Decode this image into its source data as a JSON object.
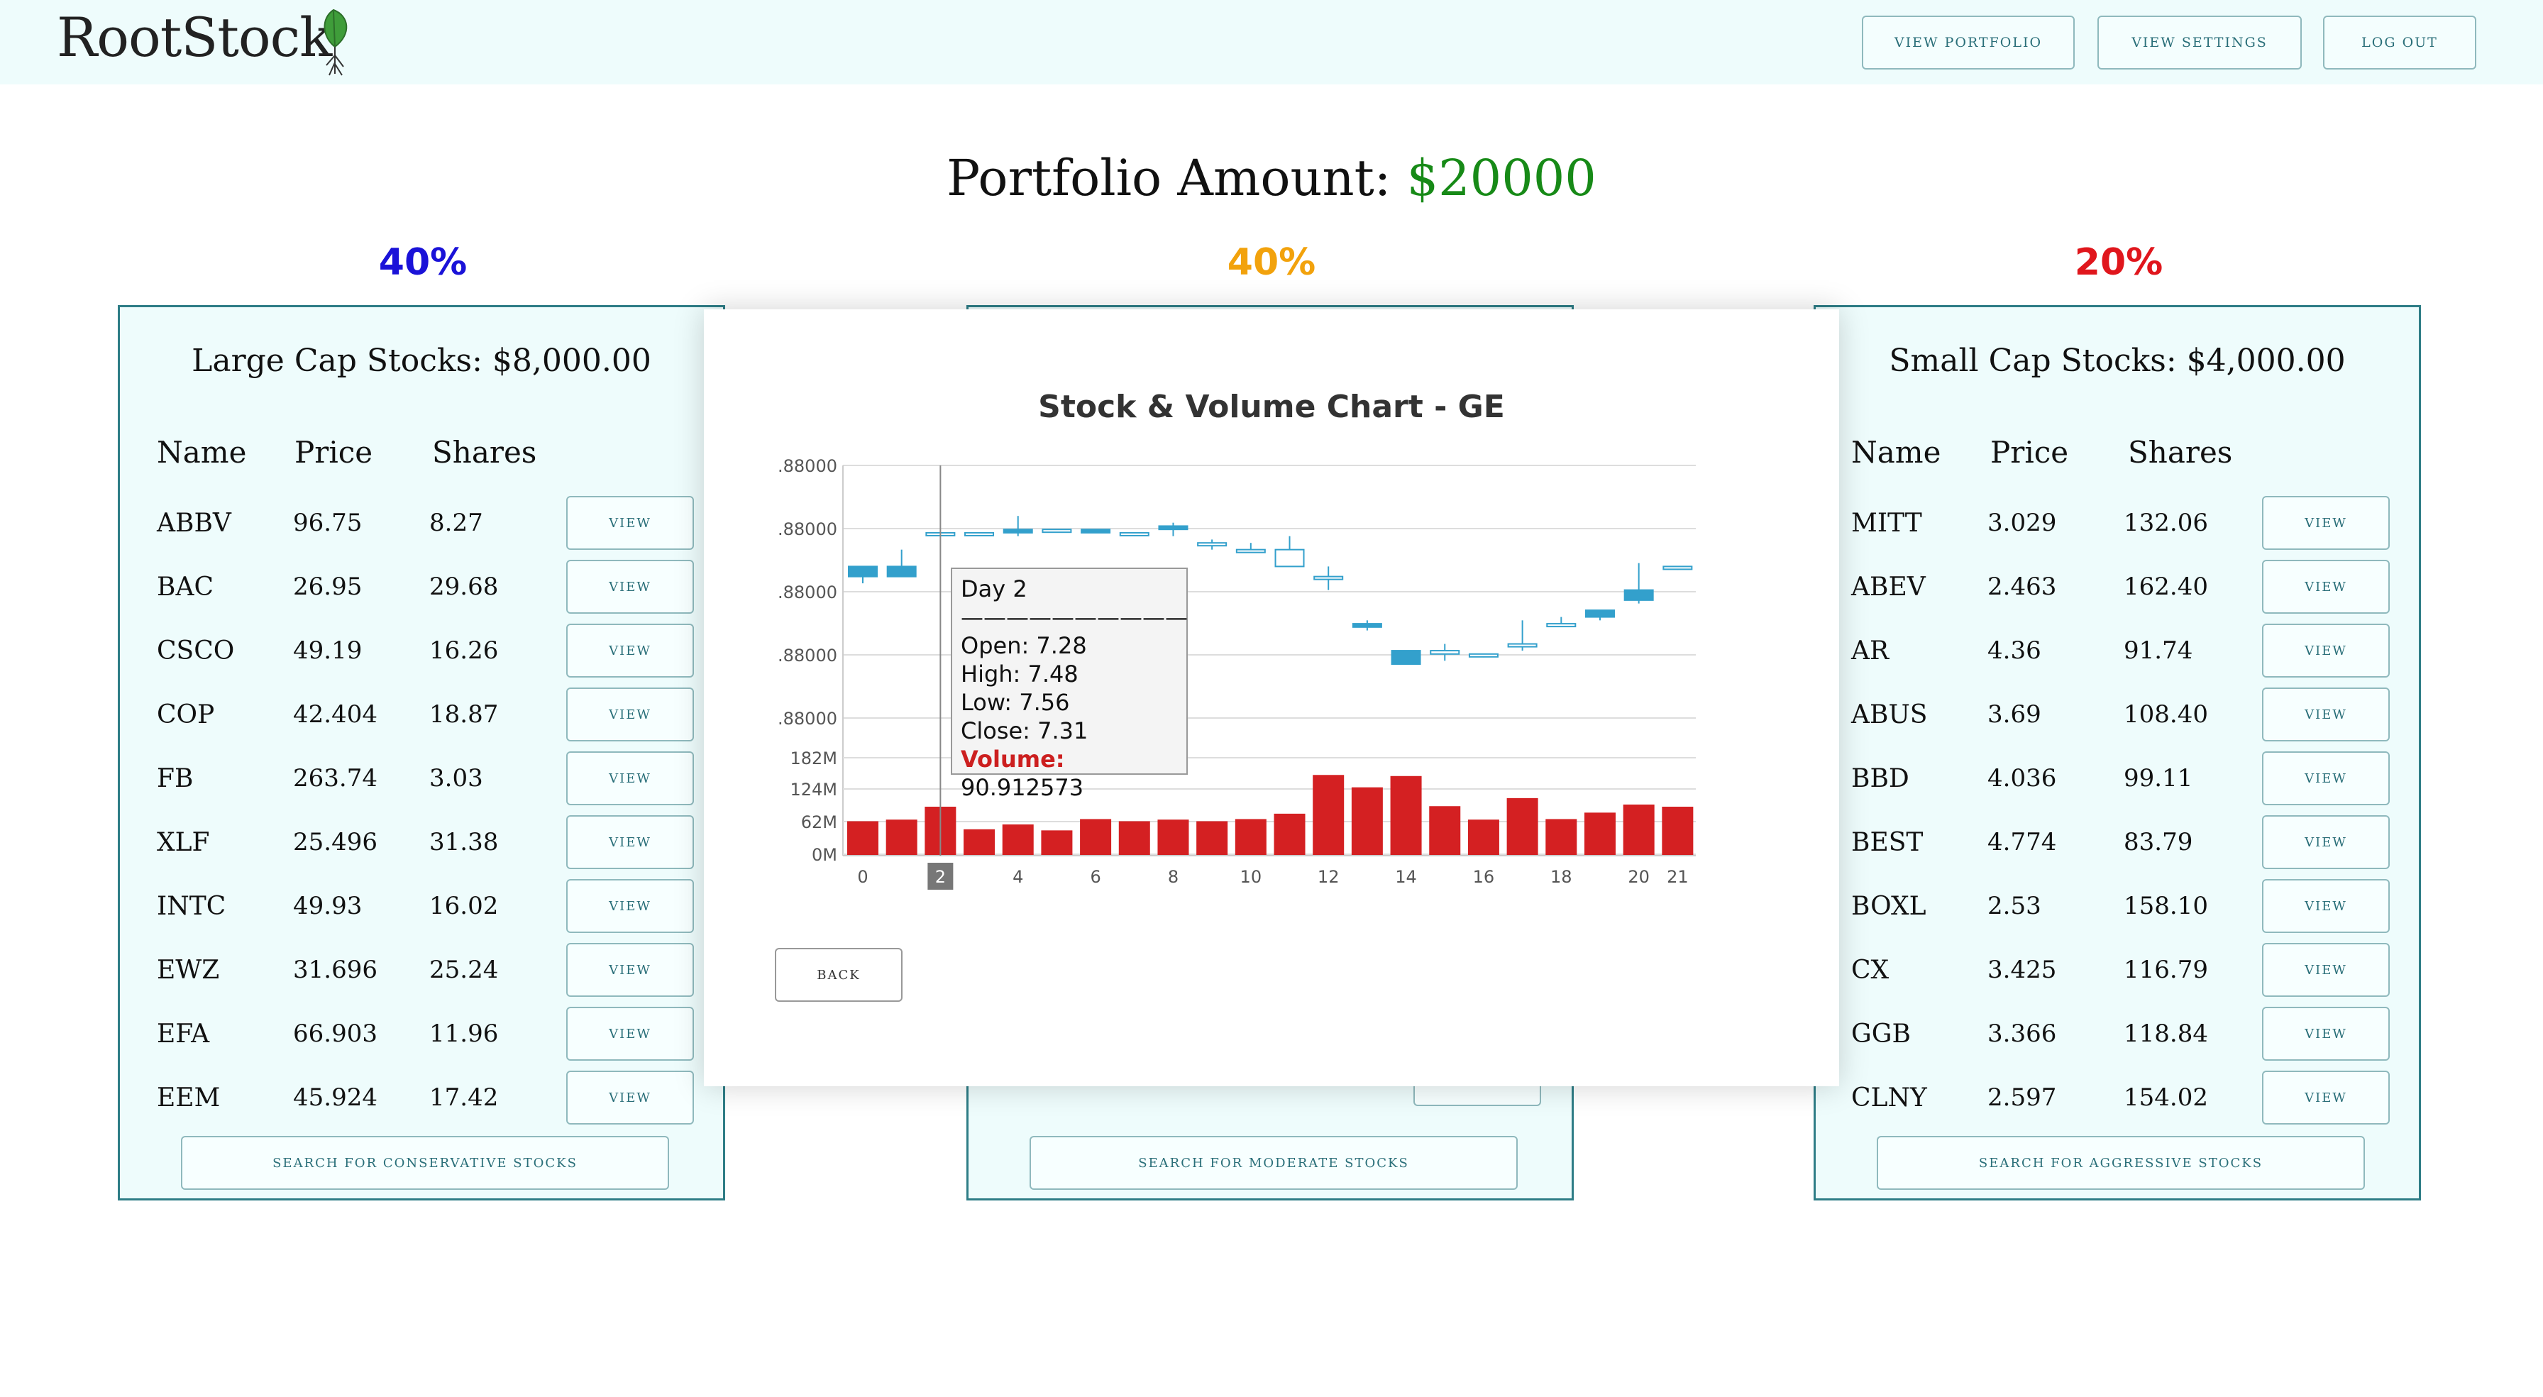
{
  "app": {
    "name": "RootStock"
  },
  "nav": {
    "portfolio": "VIEW PORTFOLIO",
    "settings": "VIEW SETTINGS",
    "logout": "LOG OUT"
  },
  "portfolio": {
    "label": "Portfolio Amount: ",
    "amount": "$20000"
  },
  "panels": [
    {
      "percent": "40%",
      "percent_color": "#1a12d8",
      "title": "Large Cap Stocks: $8,000.00",
      "headers": [
        "Name",
        "Price",
        "Shares"
      ],
      "rows": [
        {
          "name": "ABBV",
          "price": "96.75",
          "shares": "8.27"
        },
        {
          "name": "BAC",
          "price": "26.95",
          "shares": "29.68"
        },
        {
          "name": "CSCO",
          "price": "49.19",
          "shares": "16.26"
        },
        {
          "name": "COP",
          "price": "42.404",
          "shares": "18.87"
        },
        {
          "name": "FB",
          "price": "263.74",
          "shares": "3.03"
        },
        {
          "name": "XLF",
          "price": "25.496",
          "shares": "31.38"
        },
        {
          "name": "INTC",
          "price": "49.93",
          "shares": "16.02"
        },
        {
          "name": "EWZ",
          "price": "31.696",
          "shares": "25.24"
        },
        {
          "name": "EFA",
          "price": "66.903",
          "shares": "11.96"
        },
        {
          "name": "EEM",
          "price": "45.924",
          "shares": "17.42"
        }
      ],
      "view_label": "VIEW",
      "search_label": "SEARCH FOR CONSERVATIVE STOCKS"
    },
    {
      "percent": "40%",
      "percent_color": "#f2a20c",
      "search_label": "SEARCH FOR MODERATE STOCKS"
    },
    {
      "percent": "20%",
      "percent_color": "#e0161c",
      "title": "Small Cap Stocks: $4,000.00",
      "headers": [
        "Name",
        "Price",
        "Shares"
      ],
      "rows": [
        {
          "name": "MITT",
          "price": "3.029",
          "shares": "132.06"
        },
        {
          "name": "ABEV",
          "price": "2.463",
          "shares": "162.40"
        },
        {
          "name": "AR",
          "price": "4.36",
          "shares": "91.74"
        },
        {
          "name": "ABUS",
          "price": "3.69",
          "shares": "108.40"
        },
        {
          "name": "BBD",
          "price": "4.036",
          "shares": "99.11"
        },
        {
          "name": "BEST",
          "price": "4.774",
          "shares": "83.79"
        },
        {
          "name": "BOXL",
          "price": "2.53",
          "shares": "158.10"
        },
        {
          "name": "CX",
          "price": "3.425",
          "shares": "116.79"
        },
        {
          "name": "GGB",
          "price": "3.366",
          "shares": "118.84"
        },
        {
          "name": "CLNY",
          "price": "2.597",
          "shares": "154.02"
        }
      ],
      "view_label": "VIEW",
      "search_label": "SEARCH FOR AGGRESSIVE STOCKS"
    }
  ],
  "modal": {
    "back_label": "BACK",
    "tooltip": {
      "day": "Day 2",
      "separator": "——————————",
      "open": "Open: 7.28",
      "high": "High: 7.48",
      "low": "Low: 7.56",
      "close": "Close: 7.31",
      "volume_label": "Volume:",
      "volume_value": " 90.912573"
    }
  },
  "chart_data": {
    "type": "bar",
    "title": "Stock & Volume Chart - GE",
    "price_tick_labels": [
      ".88000",
      ".88000",
      ".88000",
      ".88000",
      ".88000"
    ],
    "volume_tick_labels": [
      "182M",
      "124M",
      "62M",
      "0M"
    ],
    "x_tick_labels": [
      "0",
      "2",
      "4",
      "6",
      "8",
      "10",
      "12",
      "14",
      "16",
      "18",
      "20",
      "21"
    ],
    "x": [
      0,
      1,
      2,
      3,
      4,
      5,
      6,
      7,
      8,
      9,
      10,
      11,
      12,
      13,
      14,
      15,
      16,
      17,
      18,
      19,
      20,
      21
    ],
    "volume_series": {
      "name": "Volume",
      "color": "#d42022",
      "values": [
        64,
        67,
        91,
        49,
        58,
        47,
        68,
        64,
        67,
        64,
        68,
        78,
        150,
        127,
        148,
        92,
        67,
        107,
        68,
        80,
        95,
        91
      ]
    },
    "price_series": {
      "name": "Price",
      "color": "#33a0cc",
      "open": [
        7.3,
        7.3,
        7.5,
        7.5,
        7.52,
        7.52,
        7.52,
        7.5,
        7.54,
        7.44,
        7.4,
        7.3,
        7.24,
        6.96,
        6.8,
        6.78,
        6.78,
        6.84,
        6.96,
        7.04,
        7.16,
        7.3
      ],
      "close": [
        7.24,
        7.24,
        7.5,
        7.5,
        7.5,
        7.52,
        7.5,
        7.5,
        7.52,
        7.44,
        7.4,
        7.4,
        7.24,
        6.94,
        6.72,
        6.8,
        6.78,
        6.84,
        6.96,
        7.0,
        7.1,
        7.3
      ],
      "high": [
        7.3,
        7.4,
        7.5,
        7.5,
        7.6,
        7.52,
        7.52,
        7.5,
        7.56,
        7.46,
        7.44,
        7.48,
        7.3,
        6.98,
        6.8,
        6.84,
        6.78,
        6.98,
        7.0,
        7.04,
        7.32,
        7.3
      ],
      "low": [
        7.2,
        7.24,
        7.5,
        7.48,
        7.48,
        7.5,
        7.5,
        7.48,
        7.48,
        7.4,
        7.38,
        7.36,
        7.16,
        6.92,
        6.72,
        6.74,
        6.76,
        6.8,
        6.94,
        6.98,
        7.08,
        7.28
      ]
    },
    "hover_index": 2,
    "grid": true
  }
}
